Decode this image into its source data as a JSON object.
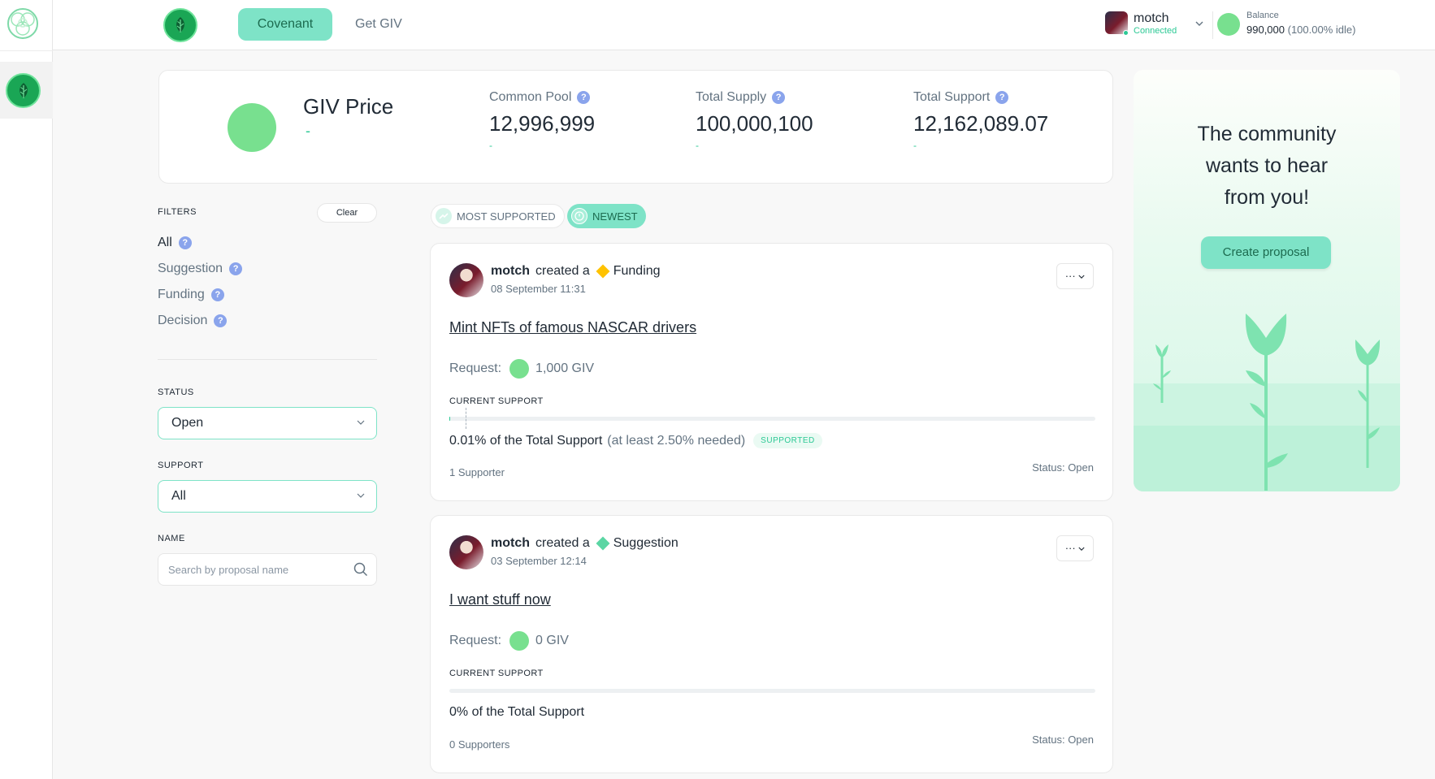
{
  "header": {
    "nav": {
      "covenant": "Covenant",
      "get_giv": "Get GIV"
    },
    "account": {
      "name": "motch",
      "status": "Connected"
    },
    "balance": {
      "label": "Balance",
      "value": "990,000",
      "idle": "(100.00% idle)"
    }
  },
  "stats": {
    "giv_price": {
      "label": "GIV Price",
      "value": "-"
    },
    "common_pool": {
      "label": "Common Pool",
      "value": "12,996,999",
      "change": "-"
    },
    "total_supply": {
      "label": "Total Supply",
      "value": "100,000,100",
      "change": "-"
    },
    "total_support": {
      "label": "Total Support",
      "value": "12,162,089.07",
      "change": "-"
    }
  },
  "community": {
    "line1": "The community",
    "line2": "wants to hear",
    "line3": "from you!",
    "button": "Create proposal"
  },
  "filters": {
    "title": "FILTERS",
    "clear": "Clear",
    "items": [
      {
        "label": "All",
        "active": true
      },
      {
        "label": "Suggestion",
        "active": false
      },
      {
        "label": "Funding",
        "active": false
      },
      {
        "label": "Decision",
        "active": false
      }
    ],
    "status": {
      "label": "STATUS",
      "value": "Open"
    },
    "support": {
      "label": "SUPPORT",
      "value": "All"
    },
    "name": {
      "label": "NAME",
      "placeholder": "Search by proposal name"
    }
  },
  "sort": {
    "most_supported": "MOST SUPPORTED",
    "newest": "NEWEST"
  },
  "proposals": [
    {
      "author": "motch",
      "created": "created a",
      "type": "Funding",
      "type_color": "#ffc200",
      "date": "08 September 11:31",
      "menu": "···",
      "title": "Mint NFTs of famous NASCAR drivers",
      "request_label": "Request:",
      "request_value": "1,000 GIV",
      "current_support_label": "CURRENT SUPPORT",
      "support_fraction": 0.0001,
      "threshold_fraction": 0.025,
      "support_text": "0.01% of the Total Support",
      "needed_text": "(at least 2.50% needed)",
      "badge": "SUPPORTED",
      "supporters": "1 Supporter",
      "status": "Status: Open"
    },
    {
      "author": "motch",
      "created": "created a",
      "type": "Suggestion",
      "type_color": "#5bd6a4",
      "date": "03 September 12:14",
      "menu": "···",
      "title": "I want stuff now",
      "request_label": "Request:",
      "request_value": "0 GIV",
      "current_support_label": "CURRENT SUPPORT",
      "support_fraction": 0,
      "support_text": "0% of the Total Support",
      "supporters": "0 Supporters",
      "status": "Status: Open"
    }
  ],
  "colors": {
    "accent": "#7ee3c7",
    "green": "#2cc995",
    "coin": "#78e08f",
    "help": "#8aa4ec"
  }
}
